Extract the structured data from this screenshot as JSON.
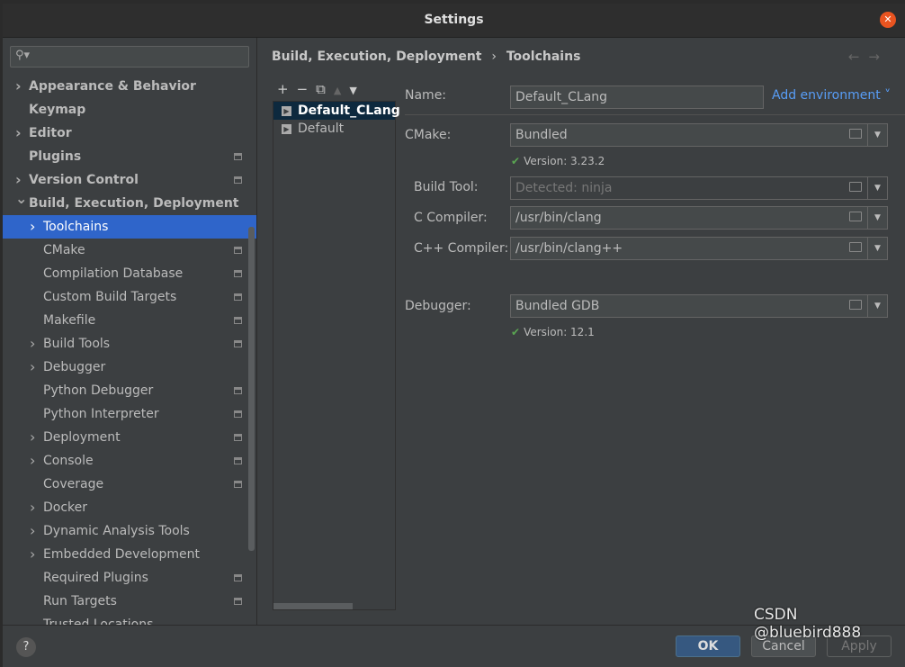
{
  "window": {
    "title": "Settings",
    "close_icon": "close-icon"
  },
  "sidebar": {
    "search_placeholder": "",
    "items": [
      {
        "label": "Appearance & Behavior",
        "level": 0,
        "arrow": true,
        "bold": true,
        "cfg": false
      },
      {
        "label": "Keymap",
        "level": 0,
        "arrow": false,
        "bold": true,
        "cfg": false
      },
      {
        "label": "Editor",
        "level": 0,
        "arrow": true,
        "bold": true,
        "cfg": false
      },
      {
        "label": "Plugins",
        "level": 0,
        "arrow": false,
        "bold": true,
        "cfg": true
      },
      {
        "label": "Version Control",
        "level": 0,
        "arrow": true,
        "bold": true,
        "cfg": true
      },
      {
        "label": "Build, Execution, Deployment",
        "level": 0,
        "arrow": "open",
        "bold": true,
        "cfg": false
      },
      {
        "label": "Toolchains",
        "level": 1,
        "arrow": true,
        "bold": false,
        "cfg": false,
        "selected": true
      },
      {
        "label": "CMake",
        "level": 1,
        "arrow": false,
        "cfg": true
      },
      {
        "label": "Compilation Database",
        "level": 1,
        "arrow": false,
        "cfg": true
      },
      {
        "label": "Custom Build Targets",
        "level": 1,
        "arrow": false,
        "cfg": true
      },
      {
        "label": "Makefile",
        "level": 1,
        "arrow": false,
        "cfg": true
      },
      {
        "label": "Build Tools",
        "level": 1,
        "arrow": true,
        "cfg": true
      },
      {
        "label": "Debugger",
        "level": 1,
        "arrow": true,
        "cfg": false
      },
      {
        "label": "Python Debugger",
        "level": 1,
        "arrow": false,
        "cfg": true
      },
      {
        "label": "Python Interpreter",
        "level": 1,
        "arrow": false,
        "cfg": true
      },
      {
        "label": "Deployment",
        "level": 1,
        "arrow": true,
        "cfg": true
      },
      {
        "label": "Console",
        "level": 1,
        "arrow": true,
        "cfg": true
      },
      {
        "label": "Coverage",
        "level": 1,
        "arrow": false,
        "cfg": true
      },
      {
        "label": "Docker",
        "level": 1,
        "arrow": true,
        "cfg": false
      },
      {
        "label": "Dynamic Analysis Tools",
        "level": 1,
        "arrow": true,
        "cfg": false
      },
      {
        "label": "Embedded Development",
        "level": 1,
        "arrow": true,
        "cfg": false
      },
      {
        "label": "Required Plugins",
        "level": 1,
        "arrow": false,
        "cfg": true
      },
      {
        "label": "Run Targets",
        "level": 1,
        "arrow": false,
        "cfg": true
      },
      {
        "label": "Trusted Locations",
        "level": 1,
        "arrow": false,
        "cfg": false
      }
    ]
  },
  "breadcrumb": {
    "parent": "Build, Execution, Deployment",
    "sep": "›",
    "current": "Toolchains"
  },
  "toolchains": {
    "toolbar": [
      "+",
      "−",
      "⧉",
      "▲",
      "▼"
    ],
    "items": [
      {
        "label": "Default_CLang",
        "selected": true
      },
      {
        "label": "Default",
        "selected": false
      }
    ]
  },
  "form": {
    "name_label": "Name:",
    "name_value": "Default_CLang",
    "add_environment": "Add environment ˅",
    "cmake_label": "CMake:",
    "cmake_value": "Bundled",
    "cmake_version": "Version: 3.23.2",
    "build_tool_label": "Build Tool:",
    "build_tool_value": "Detected: ninja",
    "c_label": "C Compiler:",
    "c_value": "/usr/bin/clang",
    "cpp_label": "C++ Compiler:",
    "cpp_value": "/usr/bin/clang++",
    "debugger_label": "Debugger:",
    "debugger_value": "Bundled GDB",
    "debugger_version": "Version: 12.1"
  },
  "buttons": {
    "help": "?",
    "ok": "OK",
    "cancel": "Cancel",
    "apply": "Apply"
  },
  "watermark": "CSDN @bluebird888",
  "colors": {
    "accent": "#2f65ca",
    "link": "#589df6",
    "ok": "#365880",
    "check": "#5aa552"
  }
}
